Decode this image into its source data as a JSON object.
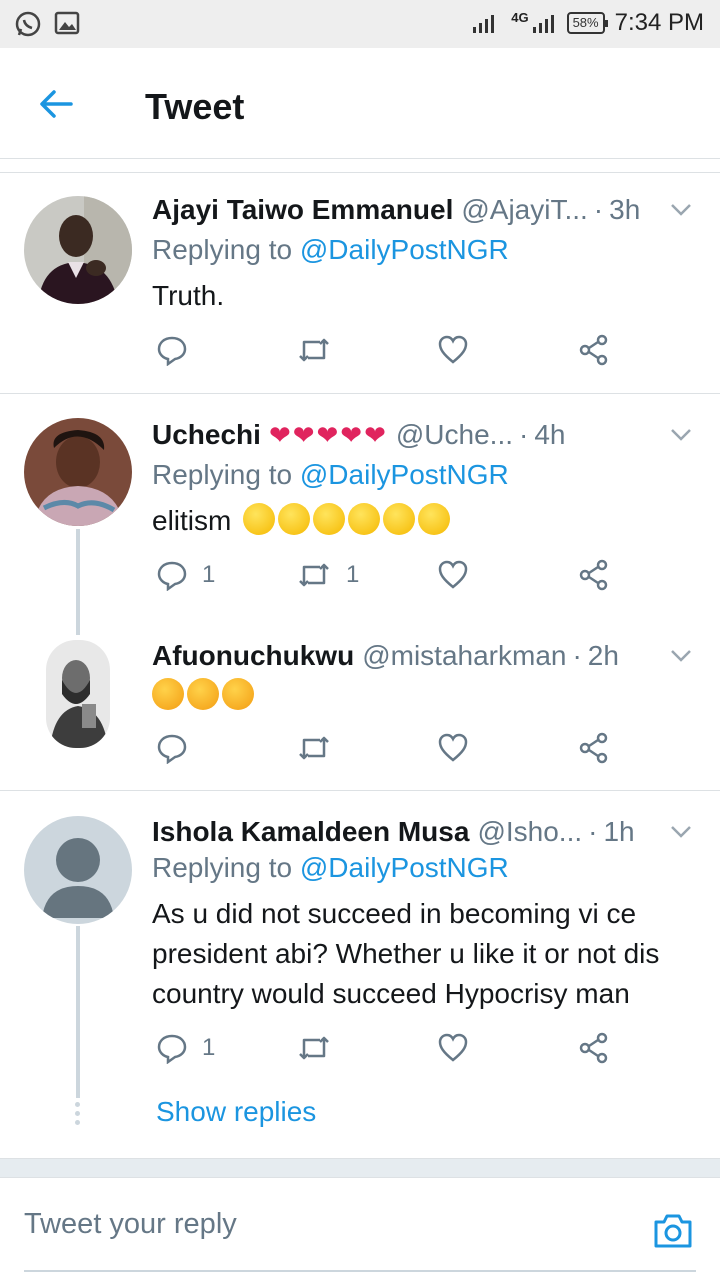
{
  "status_bar": {
    "time": "7:34 PM",
    "battery": "58%",
    "network": "4G"
  },
  "header": {
    "title": "Tweet"
  },
  "tweets": [
    {
      "name": "Ajayi Taiwo Emmanuel",
      "handle": "@AjayiT...",
      "time": "3h",
      "replying_to_prefix": "Replying to",
      "replying_to": "@DailyPostNGR",
      "text": "Truth.",
      "reply_count": "",
      "retweet_count": ""
    },
    {
      "name": "Uchechi",
      "name_suffix": "❤❤❤❤❤",
      "handle": "@Uche...",
      "time": "4h",
      "replying_to_prefix": "Replying to",
      "replying_to": "@DailyPostNGR",
      "text": "elitism",
      "reply_count": "1",
      "retweet_count": "1"
    },
    {
      "name": "Afuonuchukwu",
      "handle": "@mistaharkman",
      "time": "2h",
      "text": "",
      "reply_count": "",
      "retweet_count": ""
    },
    {
      "name": "Ishola Kamaldeen Musa",
      "handle": "@Isho...",
      "time": "1h",
      "replying_to_prefix": "Replying to",
      "replying_to": "@DailyPostNGR",
      "text": "As u did not succeed in becoming vi  ce president abi? Whether u like it or not dis country would succeed Hypocrisy man",
      "reply_count": "1",
      "retweet_count": ""
    }
  ],
  "show_replies": "Show replies",
  "compose": {
    "placeholder": "Tweet your reply"
  },
  "icons": {
    "reply": "reply-icon",
    "retweet": "retweet-icon",
    "like": "heart-icon",
    "share": "share-icon",
    "back": "back-arrow-icon",
    "camera": "camera-icon"
  },
  "colors": {
    "accent": "#1b95e0",
    "muted": "#657786",
    "heart": "#e0245e"
  }
}
